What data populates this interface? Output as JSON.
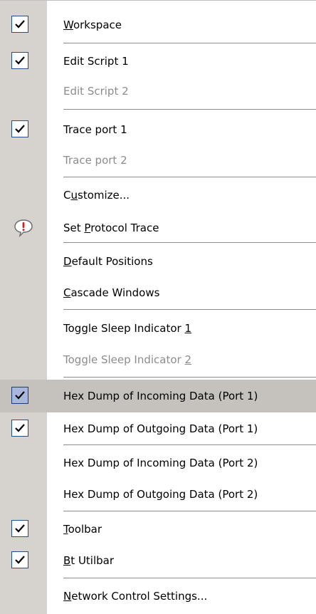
{
  "menu": {
    "items": [
      {
        "pre": "",
        "mn": "W",
        "post": "orkspace",
        "checked": true,
        "disabled": false
      },
      {
        "pre": "Edit Script 1",
        "mn": "",
        "post": "",
        "checked": true,
        "disabled": false
      },
      {
        "pre": "Edit Script 2",
        "mn": "",
        "post": "",
        "checked": false,
        "disabled": true
      },
      {
        "pre": "Trace port 1",
        "mn": "",
        "post": "",
        "checked": true,
        "disabled": false
      },
      {
        "pre": "Trace port 2",
        "mn": "",
        "post": "",
        "checked": false,
        "disabled": true
      },
      {
        "pre": "C",
        "mn": "u",
        "post": "stomize...",
        "checked": false,
        "disabled": false
      },
      {
        "pre": "Set ",
        "mn": "P",
        "post": "rotocol Trace",
        "checked": false,
        "disabled": false,
        "icon": "speech-bubble-alert-icon"
      },
      {
        "pre": "",
        "mn": "D",
        "post": "efault Positions",
        "checked": false,
        "disabled": false
      },
      {
        "pre": "",
        "mn": "C",
        "post": "ascade Windows",
        "checked": false,
        "disabled": false
      },
      {
        "pre": "Toggle Sleep Indicator ",
        "mn": "1",
        "post": "",
        "checked": false,
        "disabled": false
      },
      {
        "pre": "Toggle Sleep Indicator ",
        "mn": "2",
        "post": "",
        "checked": false,
        "disabled": true
      },
      {
        "pre": "Hex Dump of Incoming Data (Port 1)",
        "mn": "",
        "post": "",
        "checked": true,
        "disabled": false,
        "highlighted": true
      },
      {
        "pre": "Hex Dump of Outgoing Data (Port 1)",
        "mn": "",
        "post": "",
        "checked": true,
        "disabled": false
      },
      {
        "pre": "Hex Dump of Incoming Data (Port 2)",
        "mn": "",
        "post": "",
        "checked": false,
        "disabled": false
      },
      {
        "pre": "Hex Dump of Outgoing Data (Port 2)",
        "mn": "",
        "post": "",
        "checked": false,
        "disabled": false
      },
      {
        "pre": "",
        "mn": "T",
        "post": "oolbar",
        "checked": true,
        "disabled": false
      },
      {
        "pre": "",
        "mn": "B",
        "post": "t Utilbar",
        "checked": true,
        "disabled": false
      },
      {
        "pre": "",
        "mn": "N",
        "post": "etwork Control Settings...",
        "checked": false,
        "disabled": false
      }
    ]
  },
  "colors": {
    "gutter": "#d6d3ce",
    "highlight": "#c5c2bd",
    "checkbox_border": "#264d80",
    "disabled_text": "#8c8c8c"
  }
}
